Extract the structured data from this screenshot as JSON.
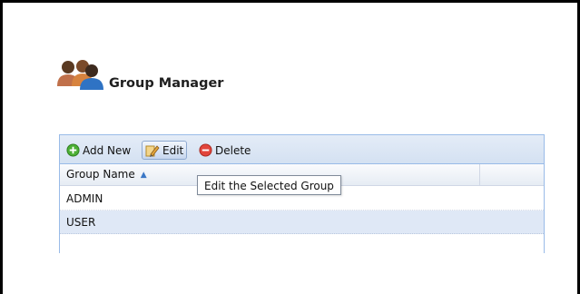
{
  "header": {
    "title": "Group Manager",
    "icon": "users-group-icon"
  },
  "toolbar": {
    "add_label": "Add New",
    "add_icon": "add-icon",
    "edit_label": "Edit",
    "edit_icon": "edit-icon",
    "delete_label": "Delete",
    "delete_icon": "delete-icon"
  },
  "grid": {
    "columns": [
      {
        "label": "Group Name",
        "sort": "ascending"
      }
    ],
    "rows": [
      {
        "name": "ADMIN",
        "selected": false
      },
      {
        "name": "USER",
        "selected": true
      }
    ]
  },
  "tooltip": {
    "text": "Edit the Selected Group"
  },
  "colors": {
    "toolbar_border": "#99bbe8",
    "selected_row": "#dfe8f6",
    "add_green": "#4caf34",
    "delete_red": "#e2453c"
  }
}
